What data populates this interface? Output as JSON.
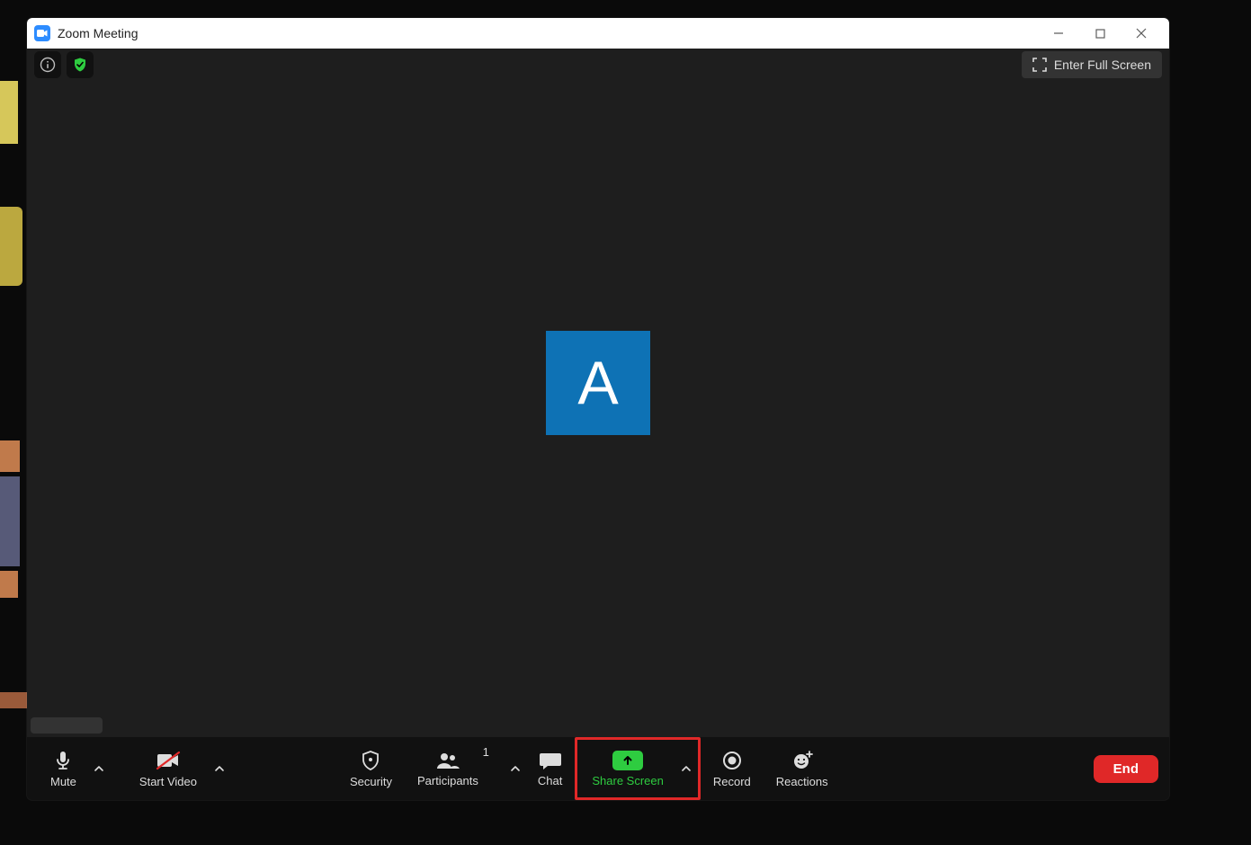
{
  "window": {
    "title": "Zoom Meeting"
  },
  "topbar": {
    "fullscreen_label": "Enter Full Screen"
  },
  "participant": {
    "initial": "A",
    "name": ""
  },
  "toolbar": {
    "mute": "Mute",
    "start_video": "Start Video",
    "security": "Security",
    "participants": "Participants",
    "participants_count": "1",
    "chat": "Chat",
    "share_screen": "Share Screen",
    "record": "Record",
    "reactions": "Reactions",
    "end": "End"
  },
  "colors": {
    "accent_green": "#2ecc40",
    "accent_red": "#e02828",
    "avatar_bg": "#0e72b5"
  }
}
